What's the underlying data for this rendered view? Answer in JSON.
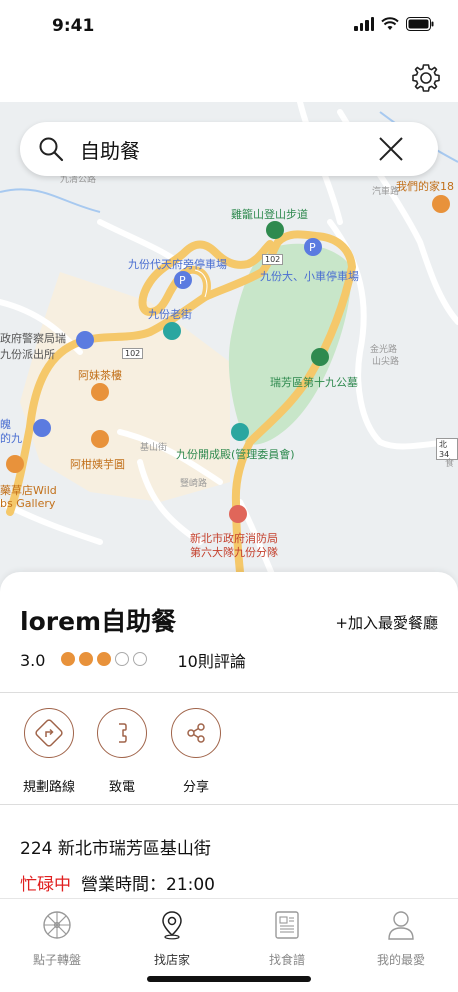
{
  "status": {
    "time": "9:41"
  },
  "search": {
    "value": "自助餐"
  },
  "map": {
    "labels": {
      "hiking": "雞籠山登山步道",
      "parking1": "九份代天府旁停車場",
      "parking2": "九份大、小車停車場",
      "oldstreet": "九份老街",
      "police1": "政府警察局瑞",
      "police2": "九份派出所",
      "teahouse": "阿妹茶樓",
      "taro": "阿柑姨芋圓",
      "cemetery": "瑞芳區第十九公墓",
      "kaicheng": "九份開成殿(管理委員會)",
      "fire1": "新北市政府消防局",
      "fire2": "第六大隊九份分隊",
      "myhome": "我們的家18",
      "herb1": "藥草店Wild",
      "herb2": "bs Gallery",
      "partial1": "魄",
      "partial2": "的九",
      "road1": "102",
      "road2": "102",
      "road3": "北34",
      "road4": "金光路",
      "misc1": "汽車路",
      "misc2": "山尖路",
      "misc3": "基山街",
      "misc4": "豎崎路",
      "misc5": "九清公路",
      "misc6": "食"
    }
  },
  "restaurant": {
    "name": "lorem自助餐",
    "add_favorite": "+加入最愛餐廳",
    "rating": "3.0",
    "rating_value": 3,
    "rating_max": 5,
    "reviews": "10則評論",
    "address": "224  新北市瑞芳區基山街",
    "status": "忙碌中",
    "hours": "營業時間：21:00"
  },
  "actions": [
    {
      "label": "規劃路線",
      "icon": "directions-icon"
    },
    {
      "label": "致電",
      "icon": "phone-icon"
    },
    {
      "label": "分享",
      "icon": "share-icon"
    }
  ],
  "tabs": [
    {
      "label": "點子轉盤",
      "icon": "wheel-icon"
    },
    {
      "label": "找店家",
      "icon": "location-pin-icon",
      "active": true
    },
    {
      "label": "找食譜",
      "icon": "recipe-icon"
    },
    {
      "label": "我的最愛",
      "icon": "user-icon"
    }
  ],
  "colors": {
    "accent": "#e8923b",
    "busy": "#e02020",
    "action_outline": "#a0644a",
    "map_green": "#c8e6c9",
    "road_yellow": "#f5c86a"
  }
}
